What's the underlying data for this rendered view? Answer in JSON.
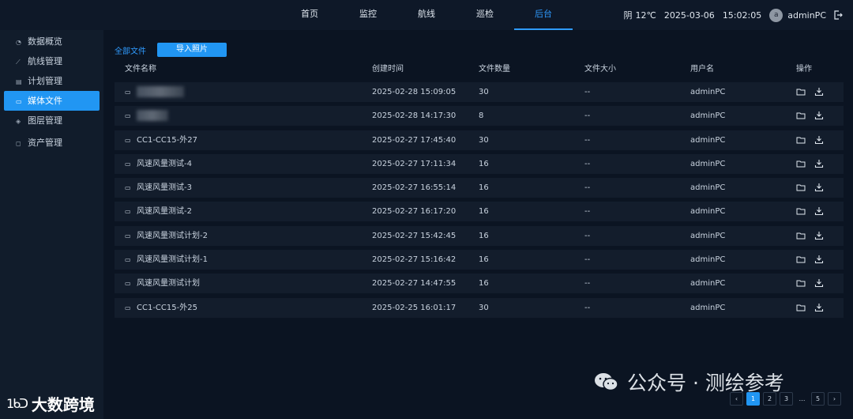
{
  "nav": {
    "items": [
      {
        "label": "首页"
      },
      {
        "label": "监控"
      },
      {
        "label": "航线"
      },
      {
        "label": "巡检"
      },
      {
        "label": "后台"
      }
    ],
    "active_index": 4
  },
  "status": {
    "weather": "阴",
    "temperature": "12℃",
    "date": "2025-03-06",
    "time": "15:02:05",
    "avatar_letter": "a",
    "username": "adminPC"
  },
  "sidebar": {
    "items": [
      {
        "label": "数据概览",
        "icon": "pie-chart-icon"
      },
      {
        "label": "航线管理",
        "icon": "route-icon"
      },
      {
        "label": "计划管理",
        "icon": "calendar-icon"
      },
      {
        "label": "媒体文件",
        "icon": "folder-icon"
      },
      {
        "label": "图层管理",
        "icon": "layers-icon"
      },
      {
        "label": "资产管理",
        "icon": "asset-icon"
      }
    ],
    "active_index": 3
  },
  "toolbar": {
    "all_files": "全部文件",
    "import_label": "导入照片"
  },
  "table": {
    "headers": {
      "name": "文件名称",
      "created": "创建时间",
      "count": "文件数量",
      "size": "文件大小",
      "user": "用户名",
      "ops": "操作"
    },
    "rows": [
      {
        "name": "",
        "created": "2025-02-28 15:09:05",
        "count": "30",
        "size": "--",
        "user": "adminPC"
      },
      {
        "name": "",
        "created": "2025-02-28 14:17:30",
        "count": "8",
        "size": "--",
        "user": "adminPC"
      },
      {
        "name": "CC1-CC15-外27",
        "created": "2025-02-27 17:45:40",
        "count": "30",
        "size": "--",
        "user": "adminPC"
      },
      {
        "name": "风速风量测试-4",
        "created": "2025-02-27 17:11:34",
        "count": "16",
        "size": "--",
        "user": "adminPC"
      },
      {
        "name": "风速风量测试-3",
        "created": "2025-02-27 16:55:14",
        "count": "16",
        "size": "--",
        "user": "adminPC"
      },
      {
        "name": "风速风量测试-2",
        "created": "2025-02-27 16:17:20",
        "count": "16",
        "size": "--",
        "user": "adminPC"
      },
      {
        "name": "风速风量测试计划-2",
        "created": "2025-02-27 15:42:45",
        "count": "16",
        "size": "--",
        "user": "adminPC"
      },
      {
        "name": "风速风量测试计划-1",
        "created": "2025-02-27 15:16:42",
        "count": "16",
        "size": "--",
        "user": "adminPC"
      },
      {
        "name": "风速风量测试计划",
        "created": "2025-02-27 14:47:55",
        "count": "16",
        "size": "--",
        "user": "adminPC"
      },
      {
        "name": "CC1-CC15-外25",
        "created": "2025-02-25 16:01:17",
        "count": "30",
        "size": "--",
        "user": "adminPC"
      }
    ]
  },
  "pagination": {
    "prev": "‹",
    "pages": [
      "1",
      "2",
      "3",
      "…",
      "5"
    ],
    "next": "›",
    "active_index": 0
  },
  "watermark": {
    "text": "公众号 · 测绘参考"
  },
  "logo": {
    "mark": "1ᑲᑐ",
    "text": "大数跨境"
  },
  "colors": {
    "accent": "#2196f3",
    "background": "#0b1422"
  }
}
